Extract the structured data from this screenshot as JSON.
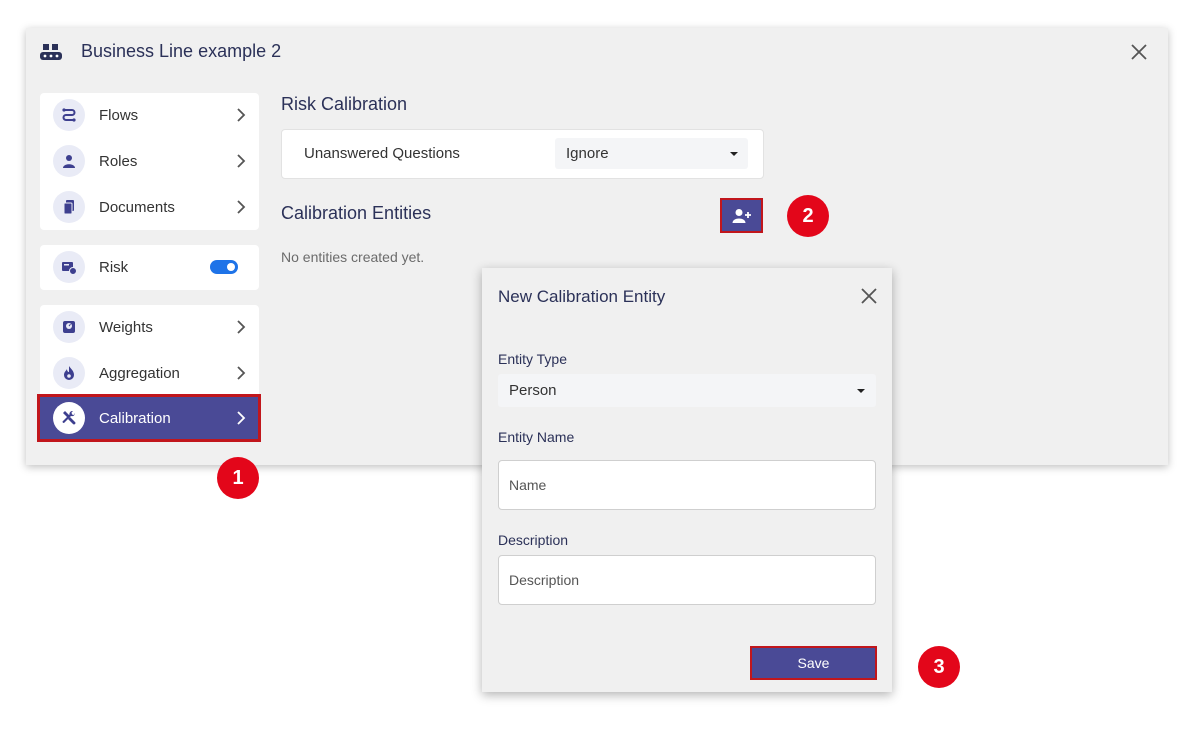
{
  "window": {
    "title": "Business Line example 2"
  },
  "sidebar": {
    "group1": [
      {
        "label": "Flows"
      },
      {
        "label": "Roles"
      },
      {
        "label": "Documents"
      }
    ],
    "risk": {
      "label": "Risk",
      "enabled": true
    },
    "group3": [
      {
        "label": "Weights"
      },
      {
        "label": "Aggregation"
      },
      {
        "label": "Calibration",
        "active": true
      }
    ]
  },
  "risk_calibration": {
    "title": "Risk Calibration",
    "unanswered_label": "Unanswered Questions",
    "unanswered_value": "Ignore"
  },
  "calibration_entities": {
    "title": "Calibration Entities",
    "empty_text": "No entities created yet."
  },
  "dialog": {
    "title": "New Calibration Entity",
    "entity_type_label": "Entity Type",
    "entity_type_value": "Person",
    "entity_name_label": "Entity Name",
    "entity_name_placeholder": "Name",
    "description_label": "Description",
    "description_placeholder": "Description",
    "save_label": "Save"
  },
  "badges": [
    "1",
    "2",
    "3"
  ],
  "colors": {
    "accent": "#4a4a96",
    "highlight": "#c1161c",
    "badge": "#e3061a",
    "toggle": "#1e73e8"
  }
}
